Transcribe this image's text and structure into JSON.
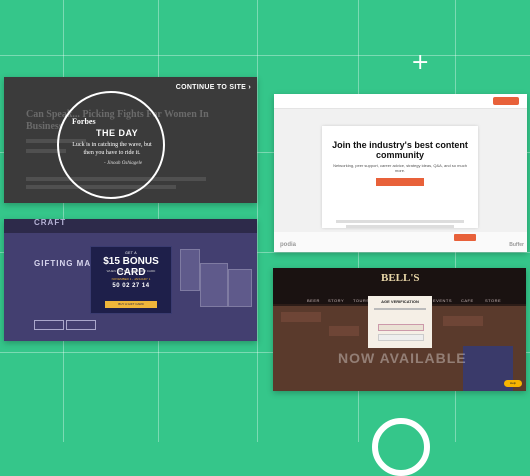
{
  "background_color": "#35c68a",
  "cards": {
    "forbes": {
      "continue_label": "CONTINUE TO SITE ›",
      "logo": "Forbes",
      "title": "THE DAY",
      "quote": "Luck is in catching the wave, but then you have to ride it.",
      "author": "- Jinoah Oshiagele"
    },
    "community": {
      "headline": "Join the industry's best content community",
      "subhead": "Networking, peer support, career advice, strategy ideas, Q&A, and so much more.",
      "brand_left": "podia",
      "brand_right": "Buffer"
    },
    "gifting": {
      "header": "CRAFT",
      "section_title": "GIFTING MADE",
      "popup_kicker": "GET A",
      "popup_title": "$15 BONUS CARD",
      "popup_sub": "WHEN YOU BUY A $50 GIFT CARD",
      "popup_dates": "NOVEMBER 1 - JANUARY 1",
      "popup_countdown": "50 02 27 14",
      "popup_button": "BUY A GIFT CARD"
    },
    "bells": {
      "logo": "BELL'S",
      "nav": [
        "BEER",
        "STORY",
        "TOURS",
        "EVENTS",
        "CAFE",
        "STORE"
      ],
      "modal_title": "AGE VERIFICATION",
      "hero_text": "NOW AVAILABLE",
      "help_label": "Help"
    }
  }
}
